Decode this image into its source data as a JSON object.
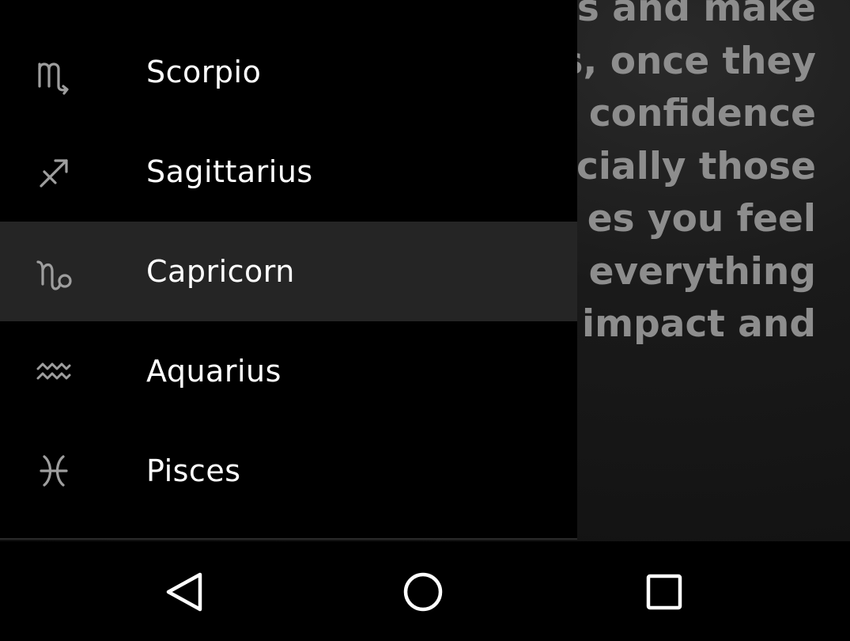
{
  "background": {
    "horoscope_lines": [
      "cts and make",
      "s, once they",
      "r confidence",
      "ecially those",
      "es you feel",
      "e everything",
      "e impact and"
    ]
  },
  "drawer": {
    "items": [
      {
        "label": "Scorpio",
        "icon": "scorpio-icon",
        "selected": false
      },
      {
        "label": "Sagittarius",
        "icon": "sagittarius-icon",
        "selected": false
      },
      {
        "label": "Capricorn",
        "icon": "capricorn-icon",
        "selected": true
      },
      {
        "label": "Aquarius",
        "icon": "aquarius-icon",
        "selected": false
      },
      {
        "label": "Pisces",
        "icon": "pisces-icon",
        "selected": false
      }
    ]
  },
  "navbar": {
    "buttons": [
      {
        "name": "back",
        "icon": "back-triangle-icon"
      },
      {
        "name": "home",
        "icon": "home-circle-icon"
      },
      {
        "name": "recents",
        "icon": "recents-square-icon"
      }
    ]
  },
  "colors": {
    "drawer_bg": "#000000",
    "selected_item_bg": "#252525",
    "label_text": "#ffffff",
    "icon_color": "#9e9e9e",
    "background_text": "#8d8d8d"
  }
}
